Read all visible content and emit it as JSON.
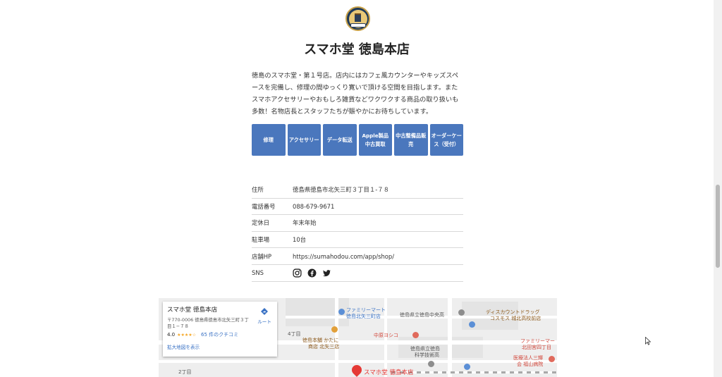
{
  "store": {
    "name": "スマホ堂 徳島本店",
    "description": "徳島のスマホ堂・第１号店。店内にはカフェ風カウンターやキッズスペースを完備し、修理の間ゆっくり寛いで頂ける空間を目指します。またスマホアクセサリーやおもしろ雑貨などワクワクする商品の取り扱いも多数！名物店長とスタッフたちが賑やかにお待ちしています。"
  },
  "buttons": [
    {
      "label": "修理"
    },
    {
      "label": "アクセサリー"
    },
    {
      "label": "データ転送"
    },
    {
      "label": "Apple製品中古買取"
    },
    {
      "label": "中古整備品販売"
    },
    {
      "label": "オーダーケース（受付）"
    }
  ],
  "info": {
    "address": {
      "label": "住所",
      "value": "徳島県徳島市北矢三町３丁目１-７８"
    },
    "phone": {
      "label": "電話番号",
      "value": "088-679-9671"
    },
    "holiday": {
      "label": "定休日",
      "value": "年末年始"
    },
    "parking": {
      "label": "駐車場",
      "value": "10台"
    },
    "website": {
      "label": "店舗HP",
      "value": "https://sumahodou.com/app/shop/"
    },
    "sns": {
      "label": "SNS",
      "icons": [
        "instagram-icon",
        "facebook-icon",
        "twitter-icon"
      ]
    }
  },
  "map": {
    "card": {
      "name": "スマホ堂 徳島本店",
      "address": "〒770-0006 徳島県徳島市北矢三町３丁目１−７８",
      "rating": "4.0",
      "stars": "★★★★☆",
      "reviews": "65 件のクチコミ",
      "route": "ルート",
      "larger_map": "拡大地図を表示"
    },
    "pin_label": "スマホ堂 徳島本店",
    "labels": {
      "fm1": "ファミリーマート",
      "fm1b": "徳島北矢三町店",
      "school": "徳島県立徳島中央高",
      "discount1": "ディスカウントドラッグ",
      "discount2": "コスモス 城北高校前店",
      "block4": "4丁目",
      "nakahara": "中原ヨシコ",
      "kataniya1": "徳島本舗 かたに",
      "kataniya2": "商店 北矢三店",
      "science1": "徳島県立徳島",
      "science2": "科学技術高",
      "fm2a": "ファミリーマー",
      "fm2b": "北田宮四丁目",
      "block2": "2丁目",
      "hospital1": "医療法人三輝",
      "hospital2": "会 福山病院"
    },
    "colors": {
      "poi_blue": "#3a72c4",
      "poi_red": "#d2473b",
      "pin": "#e53935"
    }
  },
  "colors": {
    "button_bg": "#4a77bd",
    "link": "#3a72c4"
  }
}
